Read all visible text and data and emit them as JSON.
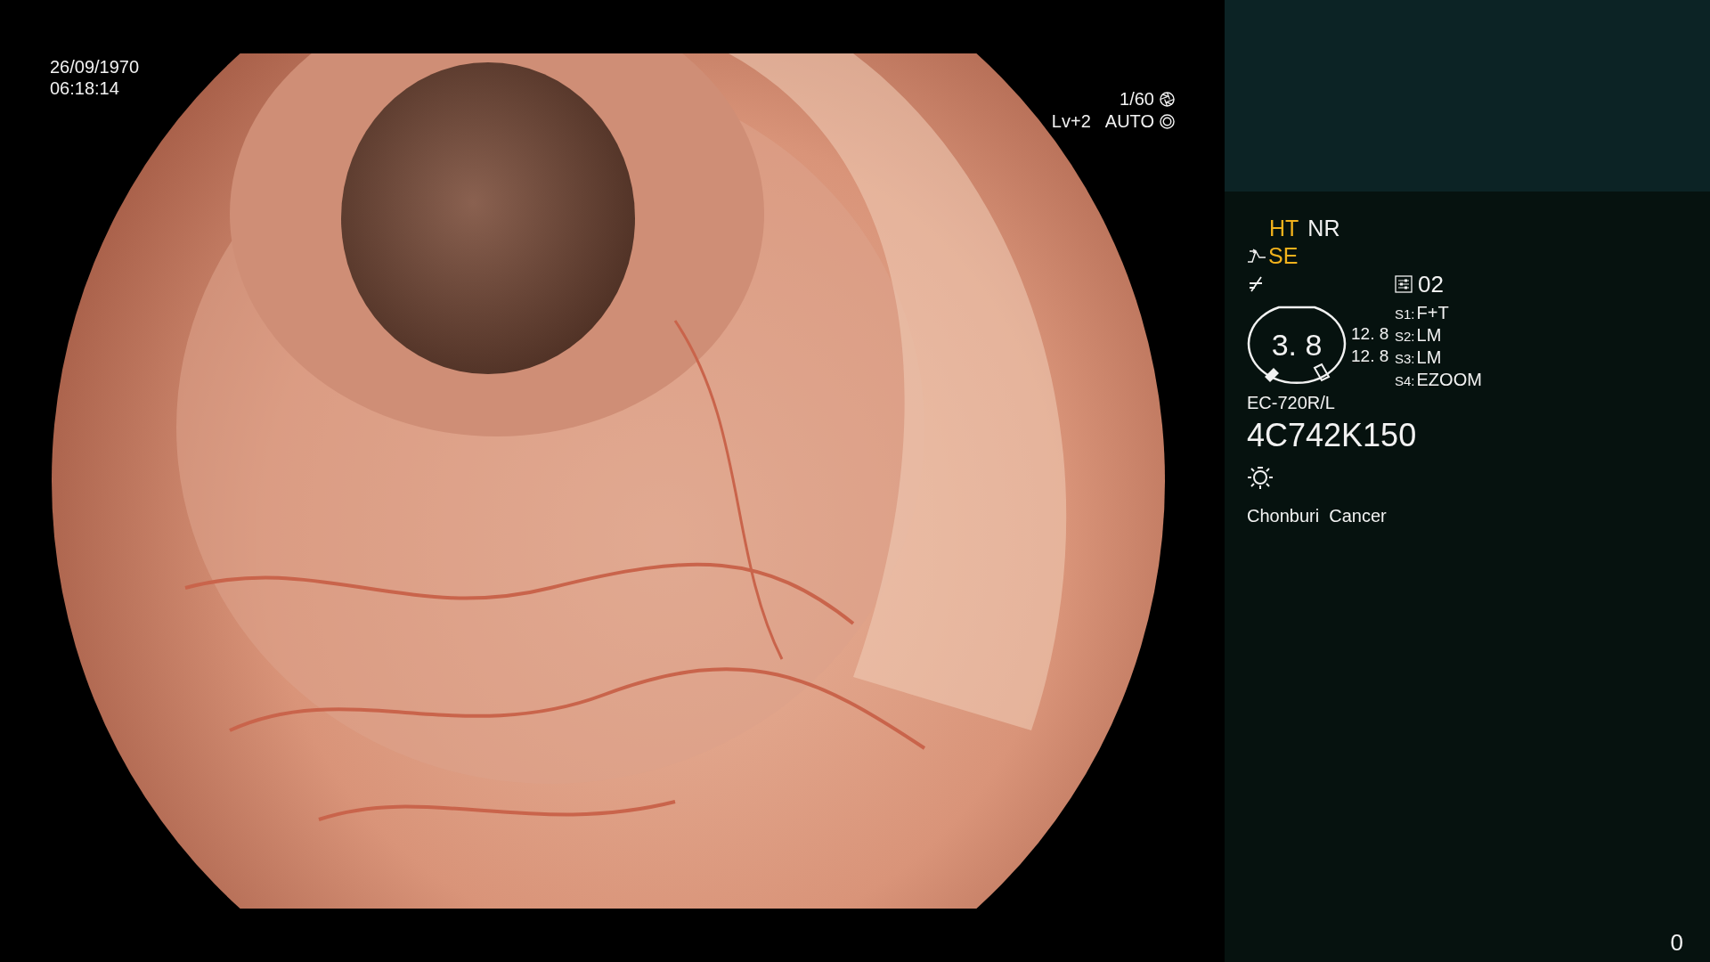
{
  "timestamp": {
    "date": "26/09/1970",
    "time": "06:18:14"
  },
  "exposure": {
    "shutter": "1/60",
    "brightness": "Lv+2",
    "iris": "AUTO"
  },
  "modes": [
    {
      "label": "HT",
      "active": true
    },
    {
      "label": "NR",
      "active": false
    }
  ],
  "enhancement": {
    "label": "SE",
    "active": true
  },
  "preset": "02",
  "gauge": {
    "value": "3. 8",
    "readings": [
      "12. 8",
      "12. 8"
    ]
  },
  "switches": [
    {
      "key": "S1:",
      "value": "F+T"
    },
    {
      "key": "S2:",
      "value": "LM"
    },
    {
      "key": "S3:",
      "value": "LM"
    },
    {
      "key": "S4:",
      "value": "EZOOM"
    }
  ],
  "scope": {
    "model": "EC-720R/L",
    "serial": "4C742K150"
  },
  "institution": "Chonburi  Cancer",
  "counter": "0"
}
